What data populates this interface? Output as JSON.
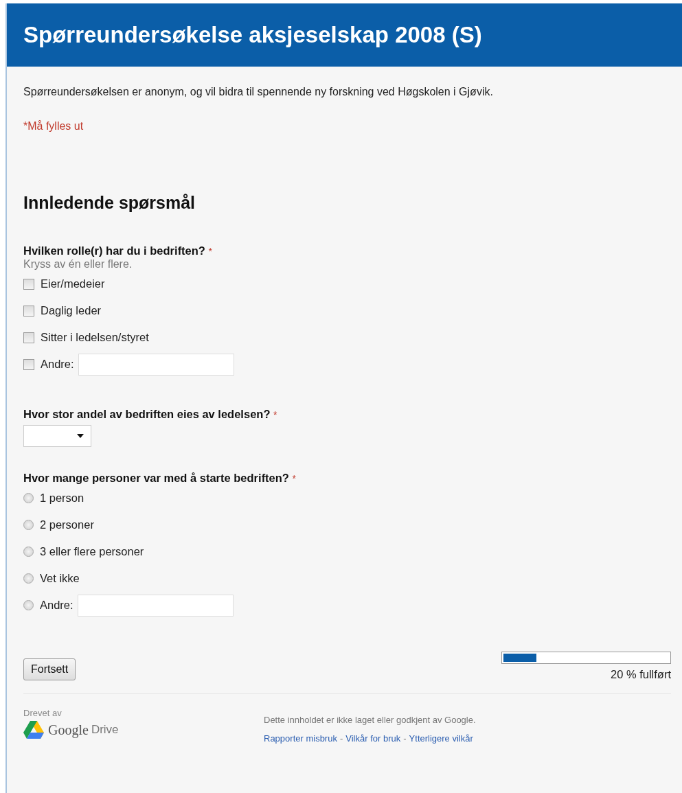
{
  "header": {
    "title": "Spørreundersøkelse aksjeselskap 2008 (S)"
  },
  "description": "Spørreundersøkelsen er anonym, og vil bidra til spennende ny forskning ved Høgskolen i Gjøvik.",
  "required_note": "*Må fylles ut",
  "section_title": "Innledende spørsmål",
  "questions": [
    {
      "kind": "checkbox",
      "title": "Hvilken rolle(r) har du i bedriften?",
      "required_mark": "*",
      "help": "Kryss av én eller flere.",
      "options": [
        {
          "label": "Eier/medeier",
          "checked": false,
          "other": false
        },
        {
          "label": "Daglig leder",
          "checked": false,
          "other": false
        },
        {
          "label": "Sitter i ledelsen/styret",
          "checked": false,
          "other": false
        },
        {
          "label": "Andre:",
          "checked": false,
          "other": true
        }
      ]
    },
    {
      "kind": "dropdown",
      "title": "Hvor stor andel av bedriften eies av ledelsen?",
      "required_mark": "*"
    },
    {
      "kind": "radio",
      "title": "Hvor mange personer var med å starte bedriften?",
      "required_mark": "*",
      "options": [
        {
          "label": "1 person",
          "selected": false,
          "other": false
        },
        {
          "label": "2 personer",
          "selected": false,
          "other": false
        },
        {
          "label": "3 eller flere personer",
          "selected": false,
          "other": false
        },
        {
          "label": "Vet ikke",
          "selected": false,
          "other": false
        },
        {
          "label": "Andre:",
          "selected": false,
          "other": true
        }
      ]
    }
  ],
  "continue_button": "Fortsett",
  "progress": {
    "level": 0.2,
    "label": "20 % fullført"
  },
  "footer": {
    "powered_by": "Drevet av",
    "logo_word": "Google",
    "product": "Drive",
    "disclaimer": "Dette innholdet er ikke laget eller godkjent av Google.",
    "links": [
      "Rapporter misbruk",
      "Vilkår for bruk",
      "Ytterligere vilkår"
    ],
    "separator": "-"
  }
}
